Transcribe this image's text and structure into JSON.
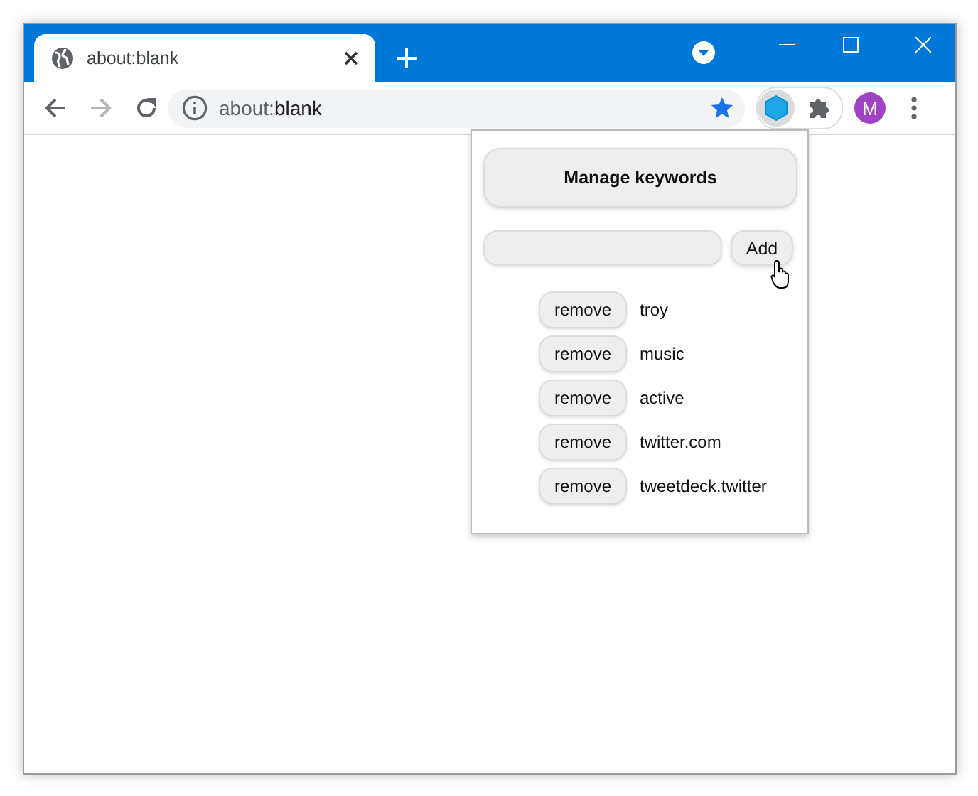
{
  "window": {
    "tab": {
      "title": "about:blank"
    },
    "address": {
      "scheme": "about:",
      "rest": "blank"
    },
    "nav": {
      "forward_disabled": true
    },
    "profile_initial": "M"
  },
  "popup": {
    "header_button": "Manage keywords",
    "add_button": "Add",
    "keywords": [
      {
        "remove_label": "remove",
        "keyword": "troy"
      },
      {
        "remove_label": "remove",
        "keyword": "music"
      },
      {
        "remove_label": "remove",
        "keyword": "active"
      },
      {
        "remove_label": "remove",
        "keyword": "twitter.com"
      },
      {
        "remove_label": "remove",
        "keyword": "tweetdeck.twitter"
      }
    ]
  }
}
